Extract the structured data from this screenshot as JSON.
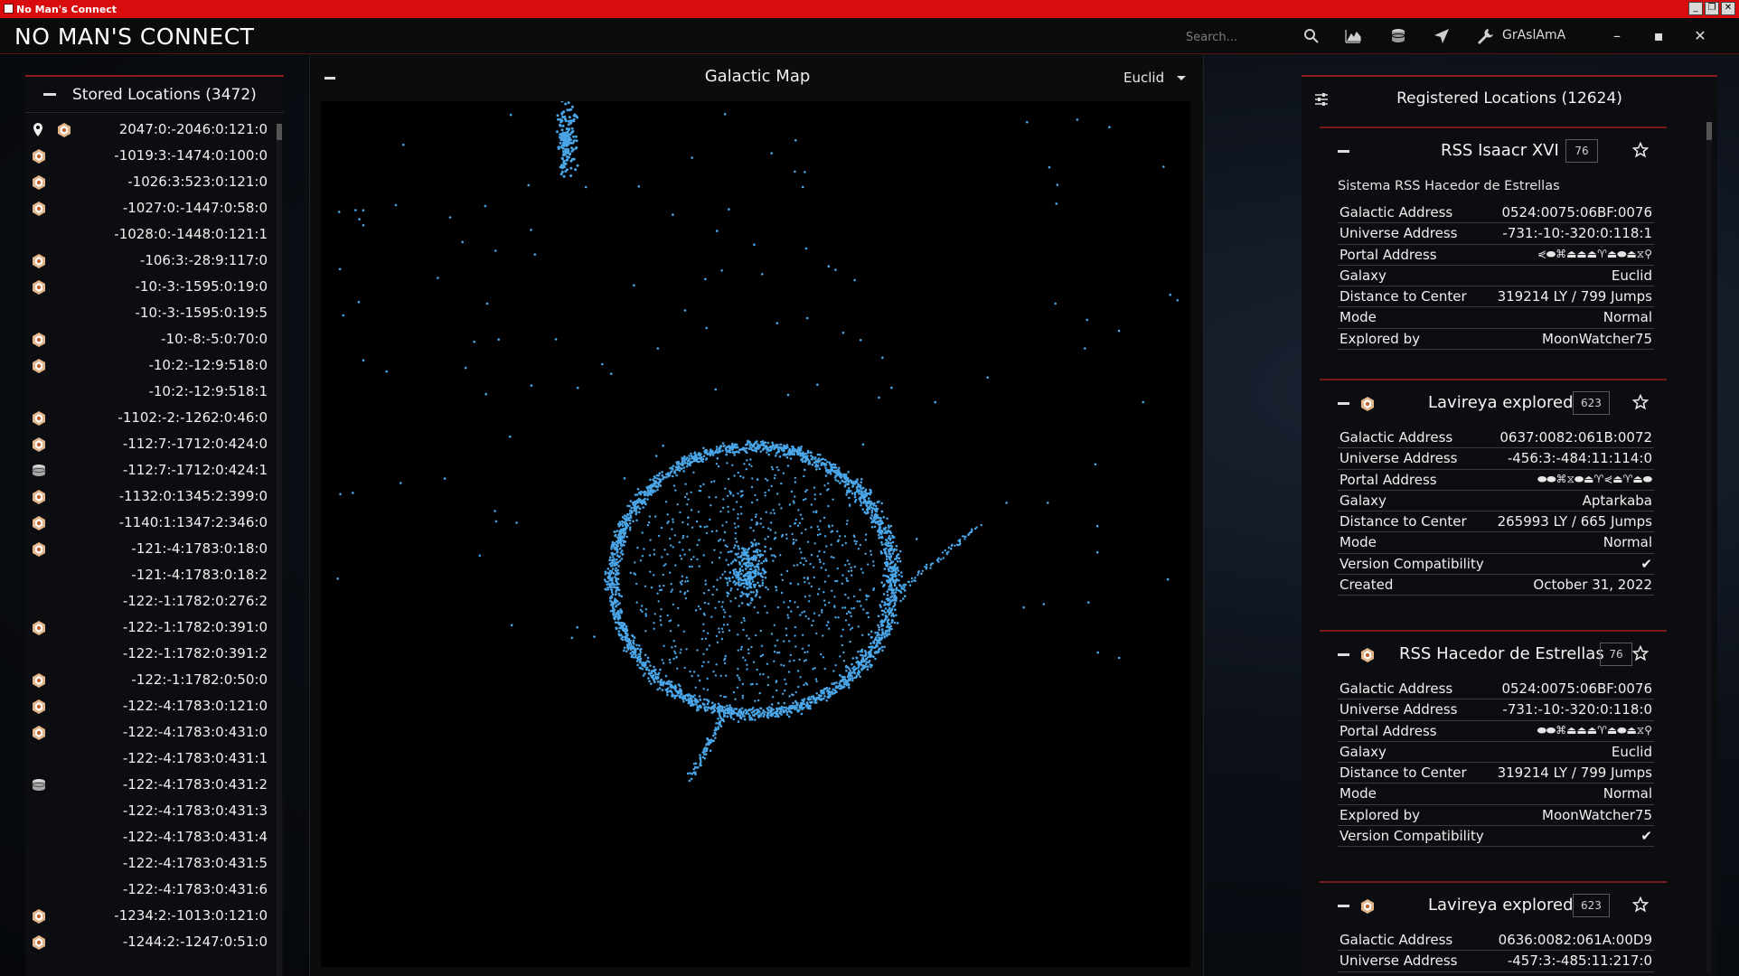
{
  "window": {
    "title": "No Man's Connect"
  },
  "header": {
    "brand": "NO MAN'S CONNECT",
    "search_placeholder": "Search...",
    "user_name": "GrAslAmA",
    "icons": [
      "search-icon",
      "chart-icon",
      "database-icon",
      "navigate-icon",
      "wrench-icon",
      "minimize-icon",
      "maximize-icon",
      "close-icon"
    ]
  },
  "stored": {
    "title": "Stored Locations (3472)",
    "items": [
      {
        "coord": "2047:0:-2046:0:121:0",
        "icon": "base",
        "pin": true
      },
      {
        "coord": "-1019:3:-1474:0:100:0",
        "icon": "base"
      },
      {
        "coord": "-1026:3:523:0:121:0",
        "icon": "base"
      },
      {
        "coord": "-1027:0:-1447:0:58:0",
        "icon": "base"
      },
      {
        "coord": "-1028:0:-1448:0:121:1",
        "icon": ""
      },
      {
        "coord": "-106:3:-28:9:117:0",
        "icon": "base"
      },
      {
        "coord": "-10:-3:-1595:0:19:0",
        "icon": "base"
      },
      {
        "coord": "-10:-3:-1595:0:19:5",
        "icon": ""
      },
      {
        "coord": "-10:-8:-5:0:70:0",
        "icon": "base"
      },
      {
        "coord": "-10:2:-12:9:518:0",
        "icon": "base"
      },
      {
        "coord": "-10:2:-12:9:518:1",
        "icon": ""
      },
      {
        "coord": "-1102:-2:-1262:0:46:0",
        "icon": "base"
      },
      {
        "coord": "-112:7:-1712:0:424:0",
        "icon": "base"
      },
      {
        "coord": "-112:7:-1712:0:424:1",
        "icon": "db"
      },
      {
        "coord": "-1132:0:1345:2:399:0",
        "icon": "base"
      },
      {
        "coord": "-1140:1:1347:2:346:0",
        "icon": "base"
      },
      {
        "coord": "-121:-4:1783:0:18:0",
        "icon": "base"
      },
      {
        "coord": "-121:-4:1783:0:18:2",
        "icon": ""
      },
      {
        "coord": "-122:-1:1782:0:276:2",
        "icon": ""
      },
      {
        "coord": "-122:-1:1782:0:391:0",
        "icon": "base"
      },
      {
        "coord": "-122:-1:1782:0:391:2",
        "icon": ""
      },
      {
        "coord": "-122:-1:1782:0:50:0",
        "icon": "base"
      },
      {
        "coord": "-122:-4:1783:0:121:0",
        "icon": "base"
      },
      {
        "coord": "-122:-4:1783:0:431:0",
        "icon": "base"
      },
      {
        "coord": "-122:-4:1783:0:431:1",
        "icon": ""
      },
      {
        "coord": "-122:-4:1783:0:431:2",
        "icon": "db"
      },
      {
        "coord": "-122:-4:1783:0:431:3",
        "icon": ""
      },
      {
        "coord": "-122:-4:1783:0:431:4",
        "icon": ""
      },
      {
        "coord": "-122:-4:1783:0:431:5",
        "icon": ""
      },
      {
        "coord": "-122:-4:1783:0:431:6",
        "icon": ""
      },
      {
        "coord": "-1234:2:-1013:0:121:0",
        "icon": "base"
      },
      {
        "coord": "-1244:2:-1247:0:51:0",
        "icon": "base"
      }
    ]
  },
  "map": {
    "title": "Galactic Map",
    "galaxy": "Euclid",
    "dot_color": "#4aa6e8"
  },
  "registered": {
    "title": "Registered Locations (12624)",
    "cards": [
      {
        "title": "RSS Isaacr XVI",
        "badge": "76",
        "has_icon": false,
        "subtitle": "Sistema RSS Hacedor de Estrellas",
        "rows": [
          {
            "k": "Galactic Address",
            "v": "0524:0075:06BF:0076"
          },
          {
            "k": "Universe Address",
            "v": "-731:-10:-320:0:118:1"
          },
          {
            "k": "Portal Address",
            "v": "⋞⬬⌘⏏⏏⏏♈⏏⬬⏏⧖⚲"
          },
          {
            "k": "Galaxy",
            "v": "Euclid"
          },
          {
            "k": "Distance to Center",
            "v": "319214 LY / 799 Jumps"
          },
          {
            "k": "Mode",
            "v": "Normal"
          },
          {
            "k": "Explored by",
            "v": "MoonWatcher75"
          }
        ]
      },
      {
        "title": "Lavireya explored",
        "badge": "623",
        "has_icon": true,
        "subtitle": "",
        "rows": [
          {
            "k": "Galactic Address",
            "v": "0637:0082:061B:0072"
          },
          {
            "k": "Universe Address",
            "v": "-456:3:-484:11:114:0"
          },
          {
            "k": "Portal Address",
            "v": "⬬⬬⌘⧖⬬⏏♈⋞⏏♈⏏⬬"
          },
          {
            "k": "Galaxy",
            "v": "Aptarkaba"
          },
          {
            "k": "Distance to Center",
            "v": "265993 LY / 665 Jumps"
          },
          {
            "k": "Mode",
            "v": "Normal"
          },
          {
            "k": "Version Compatibility",
            "v": "✔"
          },
          {
            "k": "Created",
            "v": "October 31, 2022"
          }
        ]
      },
      {
        "title": "RSS Hacedor de Estrellas",
        "badge": "76",
        "has_icon": true,
        "subtitle": "",
        "rows": [
          {
            "k": "Galactic Address",
            "v": "0524:0075:06BF:0076"
          },
          {
            "k": "Universe Address",
            "v": "-731:-10:-320:0:118:0"
          },
          {
            "k": "Portal Address",
            "v": "⬬⬬⌘⏏⏏⏏♈⏏⬬⏏⧖⚲"
          },
          {
            "k": "Galaxy",
            "v": "Euclid"
          },
          {
            "k": "Distance to Center",
            "v": "319214 LY / 799 Jumps"
          },
          {
            "k": "Mode",
            "v": "Normal"
          },
          {
            "k": "Explored by",
            "v": "MoonWatcher75"
          },
          {
            "k": "Version Compatibility",
            "v": "✔"
          }
        ]
      },
      {
        "title": "Lavireya explored",
        "badge": "623",
        "has_icon": true,
        "subtitle": "",
        "rows": [
          {
            "k": "Galactic Address",
            "v": "0636:0082:061A:00D9"
          },
          {
            "k": "Universe Address",
            "v": "-457:3:-485:11:217:0"
          }
        ]
      }
    ]
  }
}
